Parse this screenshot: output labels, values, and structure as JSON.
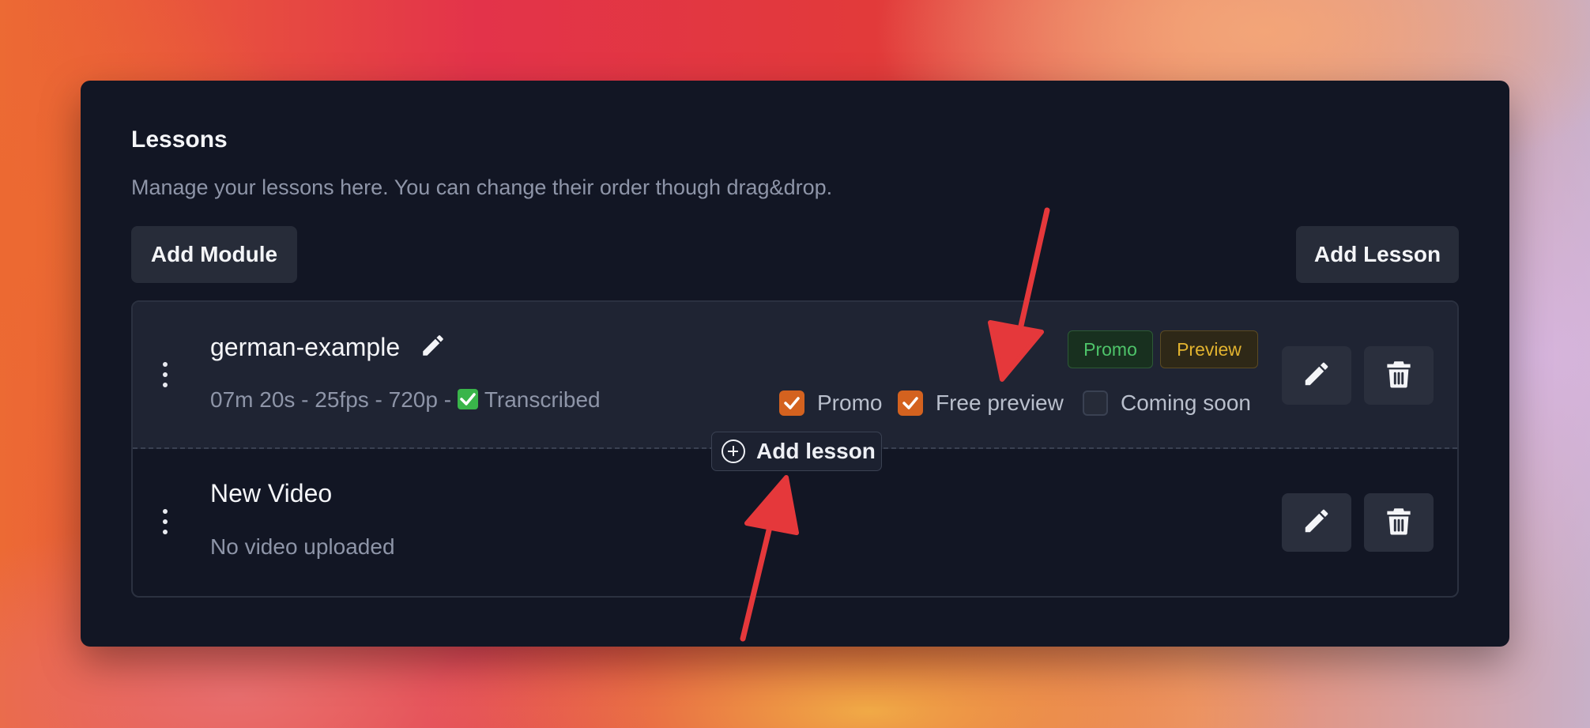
{
  "header": {
    "title": "Lessons",
    "subtitle": "Manage your lessons here. You can change their order though drag&drop."
  },
  "toolbar": {
    "add_module_label": "Add Module",
    "add_lesson_label": "Add Lesson"
  },
  "lessons": [
    {
      "name": "german-example",
      "meta_prefix": "07m 20s - 25fps - 720p - ",
      "status": "Transcribed",
      "badges": [
        "Promo",
        "Preview"
      ],
      "options": [
        {
          "label": "Promo",
          "checked": true
        },
        {
          "label": "Free preview",
          "checked": true
        },
        {
          "label": "Coming soon",
          "checked": false
        }
      ]
    },
    {
      "name": "New Video",
      "meta": "No video uploaded"
    }
  ],
  "inline_add": {
    "label": "Add lesson"
  },
  "colors": {
    "card_bg": "#121624",
    "accent_orange": "#d4621f",
    "promo_green": "#4ec46a",
    "preview_yellow": "#e2b32f",
    "annotation_red": "#e5383b"
  },
  "icons": [
    "drag-handle-icon",
    "pencil-icon",
    "trash-icon",
    "plus-circle-icon",
    "check-icon"
  ]
}
